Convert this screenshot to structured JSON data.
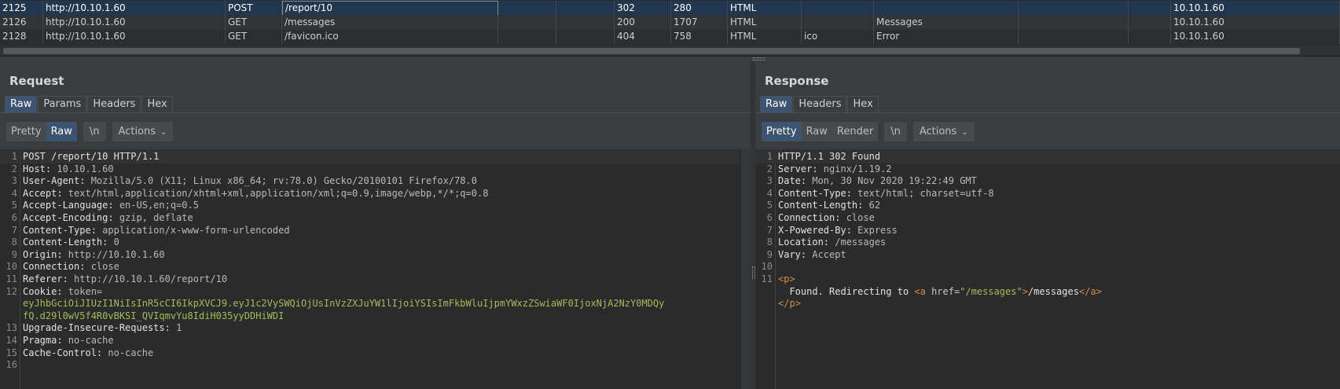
{
  "history": {
    "rows": [
      {
        "num": "2125",
        "host": "http://10.10.1.60",
        "method": "POST",
        "url": "/report/10",
        "status": "302",
        "length": "280",
        "mime": "HTML",
        "ext": "",
        "title": "",
        "ip": "10.10.1.60",
        "selected": true
      },
      {
        "num": "2126",
        "host": "http://10.10.1.60",
        "method": "GET",
        "url": "/messages",
        "status": "200",
        "length": "1707",
        "mime": "HTML",
        "ext": "",
        "title": "Messages",
        "ip": "10.10.1.60",
        "selected": false
      },
      {
        "num": "2128",
        "host": "http://10.10.1.60",
        "method": "GET",
        "url": "/favicon.ico",
        "status": "404",
        "length": "758",
        "mime": "HTML",
        "ext": "ico",
        "title": "Error",
        "ip": "10.10.1.60",
        "selected": false
      }
    ]
  },
  "request": {
    "title": "Request",
    "tabs": [
      "Raw",
      "Params",
      "Headers",
      "Hex"
    ],
    "active_tab": 0,
    "view_buttons": [
      "Pretty",
      "Raw"
    ],
    "active_view": 1,
    "newline_label": "\\n",
    "actions_label": "Actions",
    "lines": [
      {
        "n": "1",
        "k": "POST /report/10 HTTP/1.1",
        "v": ""
      },
      {
        "n": "2",
        "k": "Host:",
        "v": " 10.10.1.60"
      },
      {
        "n": "3",
        "k": "User-Agent:",
        "v": " Mozilla/5.0 (X11; Linux x86_64; rv:78.0) Gecko/20100101 Firefox/78.0"
      },
      {
        "n": "4",
        "k": "Accept:",
        "v": " text/html,application/xhtml+xml,application/xml;q=0.9,image/webp,*/*;q=0.8"
      },
      {
        "n": "5",
        "k": "Accept-Language:",
        "v": " en-US,en;q=0.5"
      },
      {
        "n": "6",
        "k": "Accept-Encoding:",
        "v": " gzip, deflate"
      },
      {
        "n": "7",
        "k": "Content-Type:",
        "v": " application/x-www-form-urlencoded"
      },
      {
        "n": "8",
        "k": "Content-Length:",
        "v": " 0"
      },
      {
        "n": "9",
        "k": "Origin:",
        "v": " http://10.10.1.60"
      },
      {
        "n": "10",
        "k": "Connection:",
        "v": " close"
      },
      {
        "n": "11",
        "k": "Referer:",
        "v": " http://10.10.1.60/report/10"
      },
      {
        "n": "12",
        "k": "Cookie:",
        "v": " token="
      },
      {
        "n": "",
        "k": "",
        "v": "",
        "t": "eyJhbGciOiJIUzI1NiIsInR5cCI6IkpXVCJ9.eyJ1c2VySWQiOjUsInVzZXJuYW1lIjoiYSIsImFkbWluIjpmYWxzZSwiaWF0IjoxNjA2NzY0MDQy"
      },
      {
        "n": "",
        "k": "",
        "v": "",
        "t": "fQ.d29l0wV5f4R0vBKSI_QVIqmvYu8IdiH035yyDDHiWDI"
      },
      {
        "n": "13",
        "k": "Upgrade-Insecure-Requests:",
        "v": " 1"
      },
      {
        "n": "14",
        "k": "Pragma:",
        "v": " no-cache"
      },
      {
        "n": "15",
        "k": "Cache-Control:",
        "v": " no-cache"
      },
      {
        "n": "16",
        "k": "",
        "v": ""
      }
    ]
  },
  "response": {
    "title": "Response",
    "tabs": [
      "Raw",
      "Headers",
      "Hex"
    ],
    "active_tab": 0,
    "view_buttons": [
      "Pretty",
      "Raw",
      "Render"
    ],
    "active_view": 0,
    "newline_label": "\\n",
    "actions_label": "Actions",
    "lines": [
      {
        "n": "1",
        "k": "HTTP/1.1 302 Found",
        "v": ""
      },
      {
        "n": "2",
        "k": "Server:",
        "v": " nginx/1.19.2"
      },
      {
        "n": "3",
        "k": "Date:",
        "v": " Mon, 30 Nov 2020 19:22:49 GMT"
      },
      {
        "n": "4",
        "k": "Content-Type:",
        "v": " text/html; charset=utf-8"
      },
      {
        "n": "5",
        "k": "Content-Length:",
        "v": " 62"
      },
      {
        "n": "6",
        "k": "Connection:",
        "v": " close"
      },
      {
        "n": "7",
        "k": "X-Powered-By:",
        "v": " Express"
      },
      {
        "n": "8",
        "k": "Location:",
        "v": " /messages"
      },
      {
        "n": "9",
        "k": "Vary:",
        "v": " Accept"
      },
      {
        "n": "10",
        "k": "",
        "v": ""
      },
      {
        "n": "11",
        "html": "p_open"
      },
      {
        "n": "",
        "html": "redirect"
      },
      {
        "n": "",
        "html": "p_close"
      }
    ],
    "body": {
      "p_open_lt": "<",
      "p_tag": "p",
      "gt": ">",
      "redirect_text": "  Found. Redirecting to ",
      "a_tag": "a",
      "href_attr": " href=",
      "href_val": "\"/messages\"",
      "link_text": "/messages",
      "a_close": "</",
      "p_close": "</"
    }
  }
}
